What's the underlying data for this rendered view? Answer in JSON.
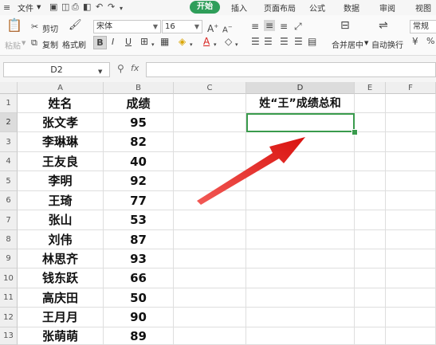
{
  "menubar": {
    "file_label": "文件",
    "tabs": [
      "开始",
      "插入",
      "页面布局",
      "公式",
      "数据",
      "审阅",
      "视图"
    ]
  },
  "toolbar": {
    "paste_label": "粘贴",
    "cut_label": "剪切",
    "copy_label": "复制",
    "format_painter_label": "格式刷",
    "font_name": "宋体",
    "font_size": "16",
    "bold_label": "B",
    "italic_label": "I",
    "underline_label": "U",
    "merge_center_label": "合并居中",
    "wrap_text_label": "自动换行",
    "number_format_label": "常规"
  },
  "formulabar": {
    "name_box": "D2",
    "fx_label": "fx",
    "formula": ""
  },
  "grid": {
    "columns": [
      "A",
      "B",
      "C",
      "D",
      "E",
      "F"
    ],
    "active_column": "D",
    "active_row": "2",
    "rows": [
      {
        "num": "1",
        "A": "姓名",
        "B": "成绩",
        "D": "姓“王”成绩总和"
      },
      {
        "num": "2",
        "A": "张文孝",
        "B": "95",
        "D": ""
      },
      {
        "num": "3",
        "A": "李琳琳",
        "B": "82"
      },
      {
        "num": "4",
        "A": "王友良",
        "B": "40"
      },
      {
        "num": "5",
        "A": "李明",
        "B": "92"
      },
      {
        "num": "6",
        "A": "王琦",
        "B": "77"
      },
      {
        "num": "7",
        "A": "张山",
        "B": "53"
      },
      {
        "num": "8",
        "A": "刘伟",
        "B": "87"
      },
      {
        "num": "9",
        "A": "林思齐",
        "B": "93"
      },
      {
        "num": "10",
        "A": "钱东跃",
        "B": "66"
      },
      {
        "num": "11",
        "A": "高庆田",
        "B": "50"
      },
      {
        "num": "12",
        "A": "王月月",
        "B": "90"
      },
      {
        "num": "13",
        "A": "张萌萌",
        "B": "89"
      }
    ]
  },
  "colors": {
    "accent": "#2f9e5a",
    "selection": "#3a9b4d",
    "arrow": "#e0201c"
  }
}
